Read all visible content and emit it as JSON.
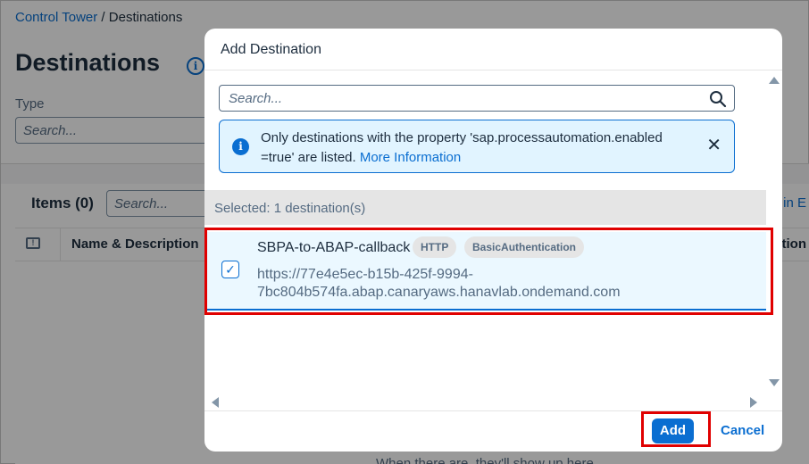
{
  "breadcrumb": {
    "root": "Control Tower",
    "separator": " / ",
    "current": "Destinations"
  },
  "page": {
    "title": "Destinations",
    "type_label": "Type",
    "type_placeholder": "Search...",
    "items_title": "Items (0)",
    "items_search_placeholder": "Search...",
    "edit_link_fragment": "in E",
    "empty_text": "When there are, they'll show up here."
  },
  "table": {
    "columns": [
      "Name & Description",
      "ation"
    ]
  },
  "dialog": {
    "title": "Add Destination",
    "search_placeholder": "Search...",
    "info_strip": {
      "text": "Only destinations with the property 'sap.processautomation.enabled =true' are listed.",
      "link": "More Information"
    },
    "selected_text": "Selected: 1 destination(s)",
    "rows": [
      {
        "name": "SBPA-to-ABAP-callback",
        "badges": [
          "HTTP",
          "BasicAuthentication"
        ],
        "url_line1": "https://77e4e5ec-b15b-425f-9994-",
        "url_line2": "7bc804b574fa.abap.canaryaws.hanavlab.ondemand.com",
        "checked": true
      }
    ],
    "add_label": "Add",
    "cancel_label": "Cancel"
  },
  "colors": {
    "accent": "#0a6ed1",
    "highlight": "#e00000",
    "info_bg": "#e1f4ff"
  },
  "icons": {
    "info": "info-icon",
    "search": "search-icon",
    "close": "close-icon",
    "check": "checkmark-icon"
  }
}
